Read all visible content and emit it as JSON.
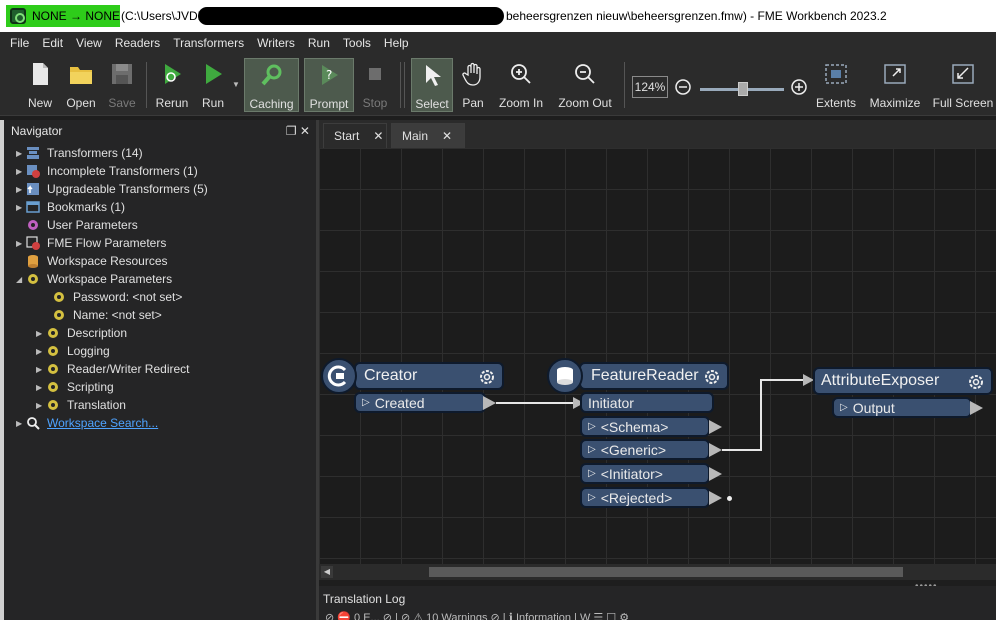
{
  "window": {
    "title_prefix": "NONE → NONE",
    "path_start": "(C:\\Users\\JVDN",
    "path_end": "beheersgrenzen nieuw\\beheersgrenzen.fmw) - FME Workbench 2023.2"
  },
  "menu": [
    "File",
    "Edit",
    "View",
    "Readers",
    "Transformers",
    "Writers",
    "Run",
    "Tools",
    "Help"
  ],
  "toolbar": {
    "new": "New",
    "open": "Open",
    "save": "Save",
    "rerun": "Rerun",
    "run": "Run",
    "caching": "Caching",
    "prompt": "Prompt",
    "stop": "Stop",
    "select": "Select",
    "pan": "Pan",
    "zoom_in": "Zoom In",
    "zoom_out": "Zoom Out",
    "zoom_level": "124%",
    "zoom_slider": 0.5,
    "extents": "Extents",
    "maximize": "Maximize",
    "full_screen": "Full Screen"
  },
  "navigator": {
    "title": "Navigator",
    "items": [
      {
        "label": "Transformers (14)"
      },
      {
        "label": "Incomplete Transformers (1)"
      },
      {
        "label": "Upgradeable Transformers (5)"
      },
      {
        "label": "Bookmarks (1)"
      },
      {
        "label": "User Parameters"
      },
      {
        "label": "FME Flow Parameters"
      },
      {
        "label": "Workspace Resources"
      },
      {
        "label": "Workspace Parameters"
      },
      {
        "label": "Password: <not set>"
      },
      {
        "label": "Name: <not set>"
      },
      {
        "label": "Description"
      },
      {
        "label": "Logging"
      },
      {
        "label": "Reader/Writer Redirect"
      },
      {
        "label": "Scripting"
      },
      {
        "label": "Translation"
      },
      {
        "label": "Workspace Search..."
      }
    ]
  },
  "tabs": [
    {
      "label": "Start",
      "close": "✕"
    },
    {
      "label": "Main",
      "close": "✕"
    }
  ],
  "canvas": {
    "creator": {
      "name": "Creator",
      "port": "Created"
    },
    "reader": {
      "name": "FeatureReader",
      "input": "Initiator",
      "ports": [
        "<Schema>",
        "<Generic>",
        "<Initiator>",
        "<Rejected>"
      ]
    },
    "exposer": {
      "name": "AttributeExposer",
      "port": "Output"
    }
  },
  "log": {
    "title": "Translation Log",
    "status": "⊘  ⛔ 0 E...   ⊘ | ⊘  ⚠ 10 Warnings   ⊘ | ℹ Information   | W  ☰ ☐ ⚙"
  },
  "colors": {
    "accent_green": "#2ecc1a",
    "node_fill": "#3a5070",
    "canvas_bg": "#1c1c1c",
    "link": "#4ea3ff"
  }
}
